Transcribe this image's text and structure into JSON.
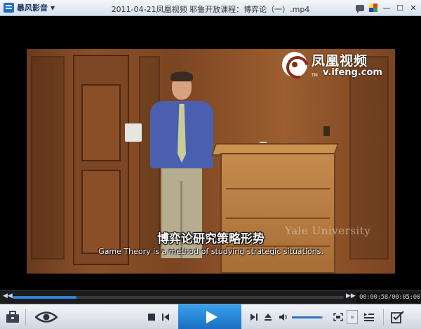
{
  "app": {
    "brand_name": "暴风影音",
    "window_title": "2011-04-21凤凰视频 耶鲁开放课程：博弈论（一）.mp4"
  },
  "window_buttons": [
    {
      "name": "chat-icon"
    },
    {
      "name": "skin-icon"
    },
    {
      "name": "minimize",
      "glyph": "—"
    },
    {
      "name": "maximize",
      "glyph": "☐"
    },
    {
      "name": "close",
      "glyph": "✕"
    }
  ],
  "video": {
    "watermark_cn": "凤凰视频",
    "watermark_url": "v.ifeng.com",
    "watermark_tm": "TM",
    "yale_watermark": "Yale University",
    "subtitle_cn": "博弈论研究策略形势",
    "subtitle_en": "Game Theory is a method of studying strategic situations."
  },
  "playback": {
    "current_time": "00:00:58",
    "total_time": "00:05:00",
    "time_display": "00:00:58/00:05:00",
    "progress_fraction": 0.193,
    "volume_fraction": 0.95
  },
  "icons": {
    "toolbox": "toolbox-icon",
    "eye": "eye-icon",
    "stop": "stop-icon",
    "prev": "previous-icon",
    "play": "play-icon",
    "next": "next-icon",
    "eject": "eject-icon",
    "volume": "volume-icon",
    "fullscreen": "fullscreen-icon",
    "playlist": "playlist-icon",
    "settings": "checklist-icon"
  },
  "colors": {
    "accent": "#2e84d6",
    "play_button": "#1a6fc2"
  }
}
